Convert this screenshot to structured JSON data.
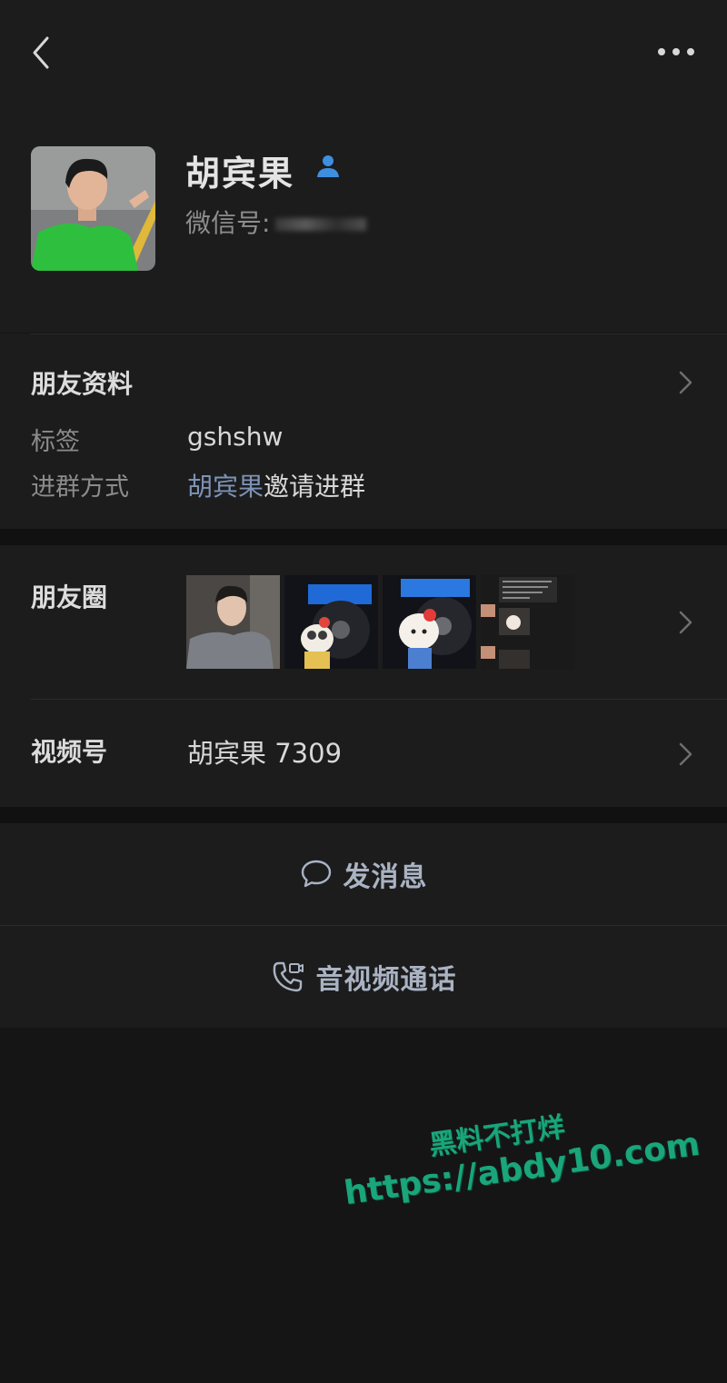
{
  "nav": {
    "back_icon": "chevron-left-icon",
    "more_icon": "more-dots-icon"
  },
  "profile": {
    "name": "胡宾果",
    "wechat_id_label": "微信号:",
    "contact_icon": "contact-person-icon"
  },
  "friend_info": {
    "title": "朋友资料",
    "tag_label": "标签",
    "tag_value": "gshshw",
    "join_label": "进群方式",
    "join_inviter": "胡宾果",
    "join_text": "邀请进群"
  },
  "moments": {
    "label": "朋友圈"
  },
  "channels": {
    "label": "视频号",
    "value": "胡宾果 7309"
  },
  "actions": {
    "message_label": "发消息",
    "message_icon": "chat-bubble-icon",
    "call_label": "音视频通话",
    "call_icon": "phone-video-icon"
  },
  "watermark": {
    "line1": "黑料不打烊",
    "line2": "https://abdy10.com"
  },
  "colors": {
    "background": "#151515",
    "card": "#1c1c1c",
    "link": "#7d93b6",
    "contact_icon": "#3d8fe0",
    "watermark": "#1aa57a"
  }
}
